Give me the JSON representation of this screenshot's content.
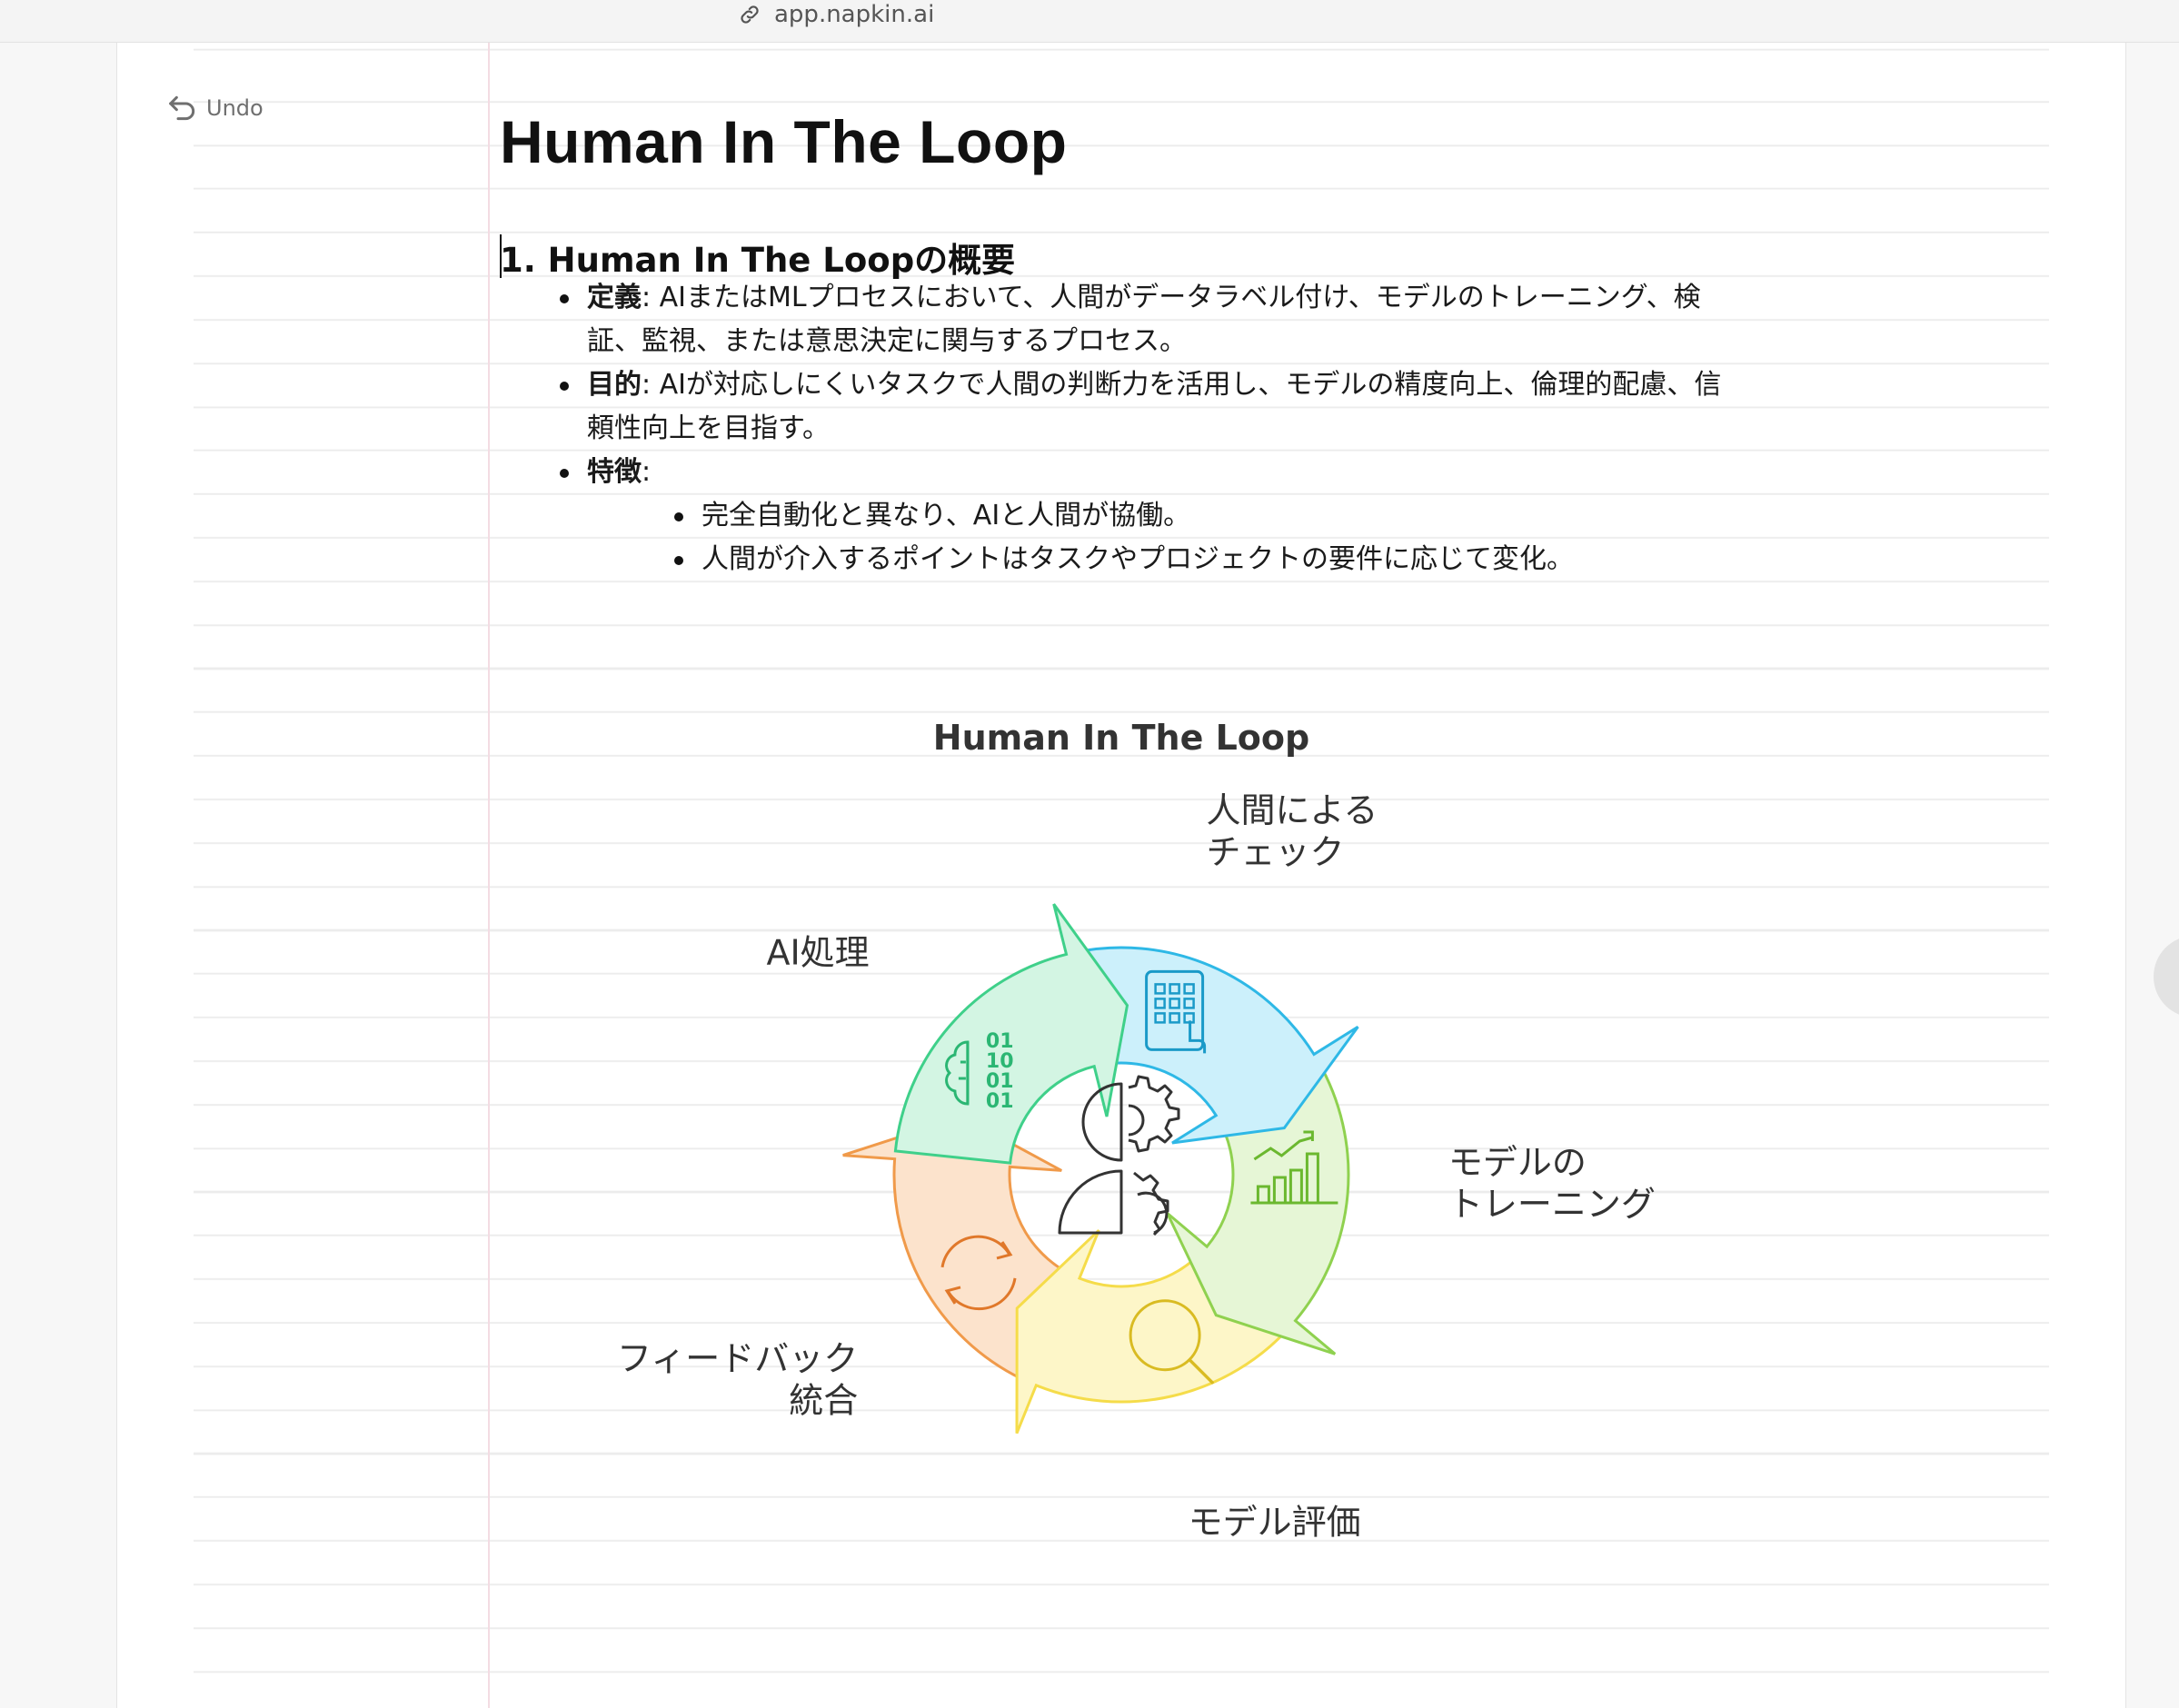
{
  "browser": {
    "url": "app.napkin.ai"
  },
  "toolbar": {
    "undo_label": "Undo"
  },
  "document": {
    "title": "Human In The Loop",
    "section_heading": "1. Human In The Loopの概要",
    "bullets": [
      {
        "term": "定義",
        "text": ": AIまたはMLプロセスにおいて、人間がデータラベル付け、モデルのトレーニング、検証、監視、または意思決定に関与するプロセス。"
      },
      {
        "term": "目的",
        "text": ": AIが対応しにくいタスクで人間の判断力を活用し、モデルの精度向上、倫理的配慮、信頼性向上を目指す。"
      },
      {
        "term": "特徴",
        "text": ":",
        "subitems": [
          "完全自動化と異なり、AIと人間が協働。",
          "人間が介入するポイントはタスクやプロジェクトの要件に応じて変化。"
        ]
      }
    ]
  },
  "diagram": {
    "title": "Human In The Loop",
    "stages": [
      {
        "label_lines": [
          "AI処理"
        ],
        "icon": "brain-binary-icon",
        "fill": "#d3f5e3",
        "stroke": "#3fd08a",
        "icon_color": "#2bb673"
      },
      {
        "label_lines": [
          "人間による",
          "チェック"
        ],
        "icon": "keypad-touch-icon",
        "fill": "#ccf0fb",
        "stroke": "#2eb8e6",
        "icon_color": "#1a9ac8"
      },
      {
        "label_lines": [
          "モデルの",
          "トレーニング"
        ],
        "icon": "bar-chart-trend-icon",
        "fill": "#e6f6d6",
        "stroke": "#8fd14f",
        "icon_color": "#6bb82f"
      },
      {
        "label_lines": [
          "モデル評価"
        ],
        "icon": "magnifier-icon",
        "fill": "#fdf6c8",
        "stroke": "#f5dc4a",
        "icon_color": "#d9bb22"
      },
      {
        "label_lines": [
          "フィードバック",
          "統合"
        ],
        "icon": "refresh-icon",
        "fill": "#fce3cc",
        "stroke": "#f09a4a",
        "icon_color": "#e0782a"
      }
    ],
    "center_icon": "human-machine-icon"
  }
}
